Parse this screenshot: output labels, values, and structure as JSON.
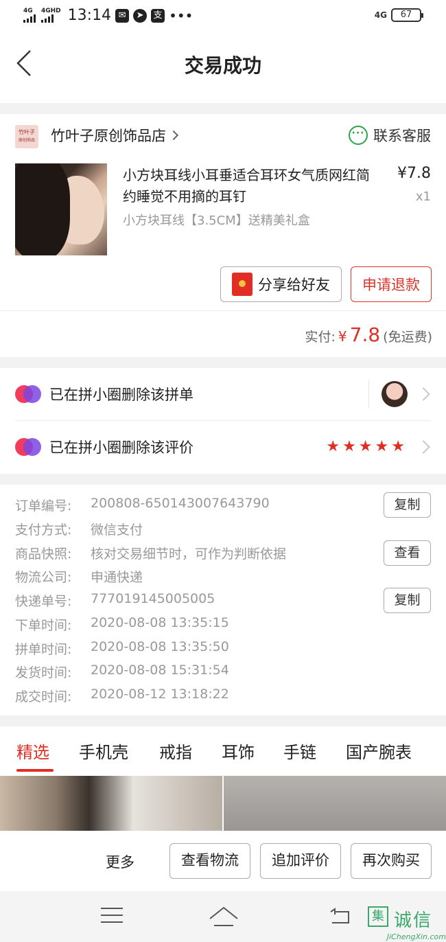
{
  "status_bar": {
    "net1": "4G",
    "net2": "4GHD",
    "time": "13:14",
    "net_right": "4G",
    "battery": "67"
  },
  "header": {
    "title": "交易成功"
  },
  "store": {
    "logo_text": "竹叶子",
    "logo_sub": "原创饰品",
    "name": "竹叶子原创饰品店",
    "contact_label": "联系客服"
  },
  "product": {
    "title": "小方块耳线小耳垂适合耳环女气质网红简约睡觉不用摘的耳钉",
    "spec": "小方块耳线【3.5CM】送精美礼盒",
    "price": "¥7.8",
    "qty": "x1"
  },
  "actions_top": {
    "share_label": "分享给好友",
    "refund_label": "申请退款"
  },
  "payment": {
    "label": "实付:",
    "currency": "¥",
    "amount": "7.8",
    "shipping": "(免运费)"
  },
  "circle": {
    "row1_text": "已在拼小圈删除该拼单",
    "row2_text": "已在拼小圈删除该评价",
    "rating": 5
  },
  "order_info": {
    "rows": [
      {
        "label": "订单编号:",
        "value": "200808-650143007643790"
      },
      {
        "label": "支付方式:",
        "value": "微信支付"
      },
      {
        "label": "商品快照:",
        "value": "核对交易细节时，可作为判断依据"
      },
      {
        "label": "物流公司:",
        "value": "申通快递"
      },
      {
        "label": "快递单号:",
        "value": "777019145005005"
      },
      {
        "label": "下单时间:",
        "value": "2020-08-08 13:35:15"
      },
      {
        "label": "拼单时间:",
        "value": "2020-08-08 13:35:50"
      },
      {
        "label": "发货时间:",
        "value": "2020-08-08 15:31:54"
      },
      {
        "label": "成交时间:",
        "value": "2020-08-12 13:18:22"
      }
    ],
    "copy_label": "复制",
    "view_label": "查看"
  },
  "tabs": [
    "精选",
    "手机壳",
    "戒指",
    "耳饰",
    "手链",
    "国产腕表"
  ],
  "bottom_actions": {
    "more": "更多",
    "logistics": "查看物流",
    "add_review": "追加评价",
    "rebuy": "再次购买"
  },
  "watermark": {
    "box": "集",
    "text": "诚信",
    "url": "JiChengXin.com"
  },
  "colors": {
    "accent": "#e02e24",
    "wechat_green": "#2aa54a"
  }
}
